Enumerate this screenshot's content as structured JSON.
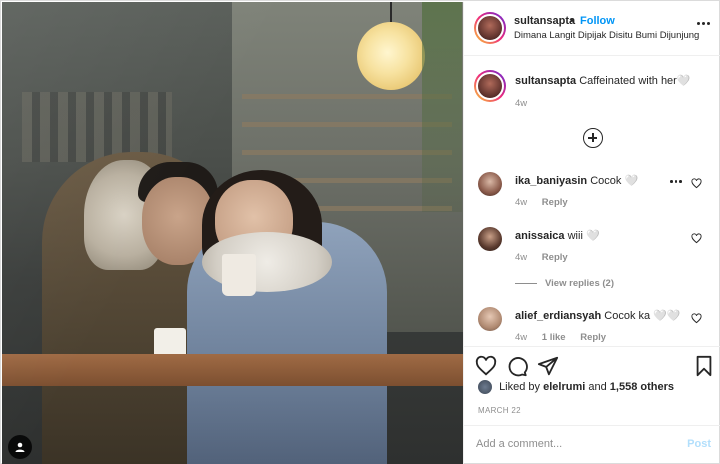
{
  "header": {
    "username": "sultansapta",
    "separator": "•",
    "follow_label": "Follow",
    "location": "Dimana Langit Dipijak Disitu Bumi Dijunjung",
    "more_icon": "more-horizontal-icon"
  },
  "caption": {
    "username": "sultansapta",
    "text": "Caffeinated with her🤍",
    "time": "4w"
  },
  "load_more_icon": "plus-circle-icon",
  "comments": [
    {
      "username": "ika_baniyasin",
      "text": "Cocok 🤍",
      "time": "4w",
      "reply_label": "Reply",
      "likes": ""
    },
    {
      "username": "anissaica",
      "text": "wiii 🤍",
      "time": "4w",
      "reply_label": "Reply",
      "likes": ""
    },
    {
      "username": "alief_erdiansyah",
      "text": "Cocok ka 🤍🤍",
      "time": "4w",
      "reply_label": "Reply",
      "likes": "1 like"
    }
  ],
  "view_replies": "View replies (2)",
  "actions": {
    "like_icon": "heart-icon",
    "comment_icon": "comment-icon",
    "share_icon": "paper-plane-icon",
    "save_icon": "bookmark-icon"
  },
  "likes": {
    "prefix": "Liked by",
    "user": "elelrumi",
    "middle": "and",
    "others": "1,558 others"
  },
  "date": "MARCH 22",
  "add_comment": {
    "placeholder": "Add a comment...",
    "post_label": "Post"
  },
  "colors": {
    "follow_blue": "#0095f6",
    "post_disabled": "#b2dffc",
    "muted": "#8e8e8e",
    "text": "#262626"
  }
}
